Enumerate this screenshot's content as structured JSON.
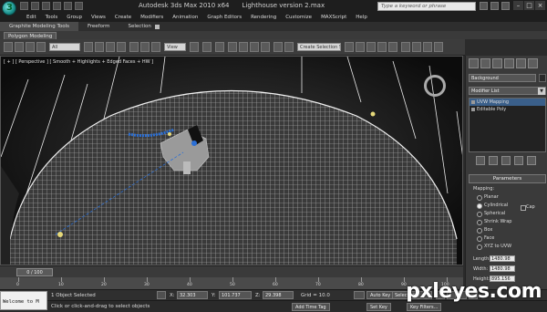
{
  "window": {
    "app_title": "Autodesk 3ds Max  2010 x64",
    "doc_title": "Lighthouse version 2.max",
    "search_placeholder": "Type a keyword or phrase"
  },
  "menu": {
    "items": [
      "Edit",
      "Tools",
      "Group",
      "Views",
      "Create",
      "Modifiers",
      "Animation",
      "Graph Editors",
      "Rendering",
      "Customize",
      "MAXScript",
      "Help"
    ]
  },
  "ribbon": {
    "tabs": [
      "Graphite Modeling Tools",
      "Freeform",
      "Selection"
    ],
    "subtab": "Polygon Modeling"
  },
  "toolbar": {
    "filter": "All",
    "view": "View",
    "create_selection": "Create Selection Se"
  },
  "viewport": {
    "label": "[ + ] [ Perspective ] [ Smooth + Highlights + Edged Faces + HW ]"
  },
  "time": {
    "slider": "0 / 100",
    "ticks": [
      "0",
      "10",
      "20",
      "30",
      "40",
      "50",
      "60",
      "70",
      "80",
      "90",
      "100"
    ]
  },
  "status": {
    "maxscript": "Welcome to M",
    "selected": "1 Object Selected",
    "prompt": "Click or click-and-drag to select objects",
    "x_label": "X:",
    "x": "32.303",
    "y_label": "Y:",
    "y": "101.737",
    "z_label": "Z:",
    "z": "29.398",
    "grid": "Grid = 10.0",
    "add_time_tag": "Add Time Tag",
    "auto_key": "Auto Key",
    "auto_key_mode": "Selected",
    "set_key": "Set Key",
    "key_filters": "Key Filters..."
  },
  "command_panel": {
    "object_name": "Background",
    "modifier_list": "Modifier List",
    "stack": [
      "UVW Mapping",
      "Editable Poly"
    ],
    "rollout": "Parameters",
    "mapping_label": "Mapping:",
    "mapping_options": [
      "Planar",
      "Cylindrical",
      "Spherical",
      "Shrink Wrap",
      "Box",
      "Face",
      "XYZ to UVW"
    ],
    "mapping_selected": "Cylindrical",
    "cap_label": "Cap",
    "length_label": "Length:",
    "length": "1480.98",
    "width_label": "Width:",
    "width": "1480.98",
    "height_label": "Height:",
    "height": "895.156"
  },
  "watermark": "pxleyes.com",
  "colors": {
    "viewport_bg": "#111111",
    "mesh": "#d9d9d9",
    "selection_blue": "#2a6fd6",
    "stack_selected": "#3a5f8a"
  }
}
